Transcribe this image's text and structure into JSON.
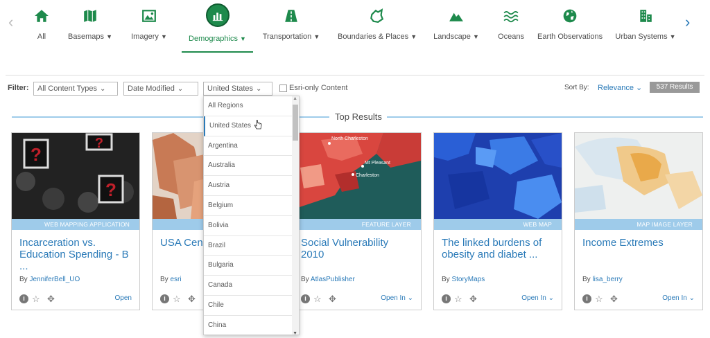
{
  "nav": {
    "categories": [
      {
        "label": "All",
        "icon": "home-icon"
      },
      {
        "label": "Basemaps",
        "icon": "map-icon",
        "caret": true
      },
      {
        "label": "Imagery",
        "icon": "image-icon",
        "caret": true
      },
      {
        "label": "Demographics",
        "icon": "chart-icon",
        "caret": true,
        "active": true
      },
      {
        "label": "Transportation",
        "icon": "road-icon",
        "caret": true
      },
      {
        "label": "Boundaries & Places",
        "icon": "boundary-icon",
        "caret": true
      },
      {
        "label": "Landscape",
        "icon": "mountain-icon",
        "caret": true
      },
      {
        "label": "Oceans",
        "icon": "waves-icon"
      },
      {
        "label": "Earth Observations",
        "icon": "globe-icon"
      },
      {
        "label": "Urban Systems",
        "icon": "buildings-icon",
        "caret": true
      }
    ],
    "prev_glyph": "‹",
    "next_glyph": "›",
    "caret_glyph": "▼"
  },
  "filter": {
    "label": "Filter:",
    "content_types": "All Content Types",
    "date_modified": "Date Modified",
    "region": "United States",
    "esri_only": "Esri-only Content",
    "chevron": "⌄"
  },
  "sort": {
    "label": "Sort By:",
    "value": "Relevance ⌄",
    "results": "537 Results"
  },
  "top_results": "Top Results",
  "region_options": [
    "All Regions",
    "United States",
    "Argentina",
    "Australia",
    "Austria",
    "Belgium",
    "Bolivia",
    "Brazil",
    "Bulgaria",
    "Canada",
    "Chile",
    "China"
  ],
  "selected_region_index": 1,
  "cards": [
    {
      "type": "WEB MAPPING APPLICATION",
      "title": "Incarceration vs. Education Spending - B ...",
      "by": "By ",
      "owner": "JenniferBell_UO",
      "open": "Open"
    },
    {
      "type": "",
      "title": "USA Census Populated",
      "by": "By ",
      "owner": "esri",
      "open": ""
    },
    {
      "type": "FEATURE LAYER",
      "title": "Social Vulnerability 2010",
      "by": "By ",
      "owner": "AtlasPublisher",
      "open": "Open In ⌄"
    },
    {
      "type": "WEB MAP",
      "title": "The linked burdens of obesity and diabet ...",
      "by": "By ",
      "owner": "StoryMaps",
      "open": "Open In ⌄"
    },
    {
      "type": "MAP IMAGE LAYER",
      "title": "Income Extremes",
      "by": "By ",
      "owner": "lisa_berry",
      "open": "Open In ⌄"
    }
  ],
  "map_labels": [
    "North Charleston",
    "Mt Pleasant",
    "Charleston"
  ],
  "card_icons": {
    "info": "i",
    "star": "☆",
    "move": "✥"
  },
  "colors": {
    "accent": "#1e8a4c",
    "link": "#2a7ab8",
    "type_bar": "#9ecbea"
  }
}
